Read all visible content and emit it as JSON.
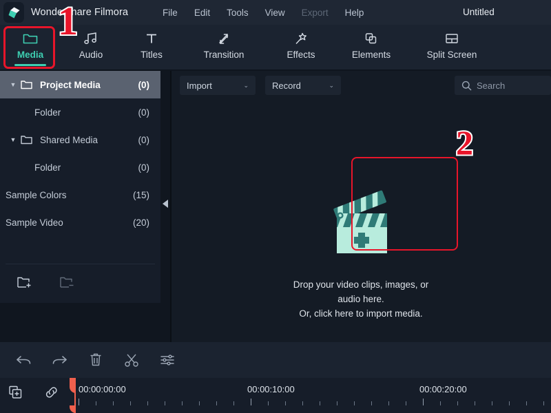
{
  "app": {
    "name": "Wondershare Filmora",
    "document_title": "Untitled",
    "logo_icon": "filmora-diamond-logo",
    "colors": {
      "accent": "#3ecfb2",
      "annotation_red": "#e8152a",
      "playhead": "#f0604d",
      "titlebar_bg": "#1f2734",
      "navbar_bg": "#1b2330",
      "sidebar_bg": "#161d29",
      "panel_bg": "#141b25",
      "selected_row_bg": "#5a6270"
    }
  },
  "menubar": {
    "items": [
      {
        "label": "File",
        "disabled": false
      },
      {
        "label": "Edit",
        "disabled": false
      },
      {
        "label": "Tools",
        "disabled": false
      },
      {
        "label": "View",
        "disabled": false
      },
      {
        "label": "Export",
        "disabled": true
      },
      {
        "label": "Help",
        "disabled": false
      }
    ]
  },
  "navbar": {
    "items": [
      {
        "label": "Media",
        "icon": "folder-icon",
        "active": true
      },
      {
        "label": "Audio",
        "icon": "music-note-icon",
        "active": false
      },
      {
        "label": "Titles",
        "icon": "text-t-icon",
        "active": false
      },
      {
        "label": "Transition",
        "icon": "transition-arrows-icon",
        "active": false
      },
      {
        "label": "Effects",
        "icon": "magic-wand-icon",
        "active": false
      },
      {
        "label": "Elements",
        "icon": "stacked-squares-icon",
        "active": false
      },
      {
        "label": "Split Screen",
        "icon": "split-screen-icon",
        "active": false
      }
    ]
  },
  "sidebar": {
    "tree": [
      {
        "label": "Project Media",
        "count": "(0)",
        "caret": "▼",
        "folder": true,
        "indent": 0,
        "selected": true
      },
      {
        "label": "Folder",
        "count": "(0)",
        "caret": "",
        "folder": false,
        "indent": 1,
        "selected": false
      },
      {
        "label": "Shared Media",
        "count": "(0)",
        "caret": "▼",
        "folder": true,
        "indent": 0,
        "selected": false
      },
      {
        "label": "Folder",
        "count": "(0)",
        "caret": "",
        "folder": false,
        "indent": 1,
        "selected": false
      },
      {
        "label": "Sample Colors",
        "count": "(15)",
        "caret": "",
        "folder": false,
        "indent": 2,
        "selected": false
      },
      {
        "label": "Sample Video",
        "count": "(20)",
        "caret": "",
        "folder": false,
        "indent": 2,
        "selected": false
      }
    ],
    "footer": {
      "new_folder_icon": "folder-plus-icon",
      "remove_folder_icon": "folder-minus-icon"
    },
    "collapse_icon": "collapse-left-arrow-icon"
  },
  "media_panel": {
    "import": {
      "label": "Import",
      "chevron": "⌄"
    },
    "record": {
      "label": "Record",
      "chevron": "⌄"
    },
    "search": {
      "placeholder": "Search",
      "value": "",
      "icon": "search-icon"
    },
    "dropzone": {
      "icon": "clapperboard-plus-icon",
      "line1": "Drop your video clips, images, or audio here.",
      "line2": "Or, click here to import media."
    }
  },
  "edit_toolbar": {
    "buttons": [
      {
        "name": "undo-button",
        "icon": "undo-arrow-icon"
      },
      {
        "name": "redo-button",
        "icon": "redo-arrow-icon"
      },
      {
        "name": "delete-button",
        "icon": "trash-icon"
      },
      {
        "name": "split-button",
        "icon": "scissors-icon"
      },
      {
        "name": "settings-button",
        "icon": "sliders-icon"
      }
    ]
  },
  "timeline": {
    "left_buttons": [
      {
        "name": "duplicate-track-button",
        "icon": "copy-squares-plus-icon"
      },
      {
        "name": "link-clips-button",
        "icon": "chain-link-icon"
      }
    ],
    "ruler_labels": [
      "00:00:00:00",
      "00:00:10:00",
      "00:00:20:00"
    ],
    "playhead_position": "00:00:00:00"
  },
  "annotations": [
    {
      "label": "1",
      "target": "media-tab"
    },
    {
      "label": "2",
      "target": "import-media-dropzone"
    }
  ]
}
